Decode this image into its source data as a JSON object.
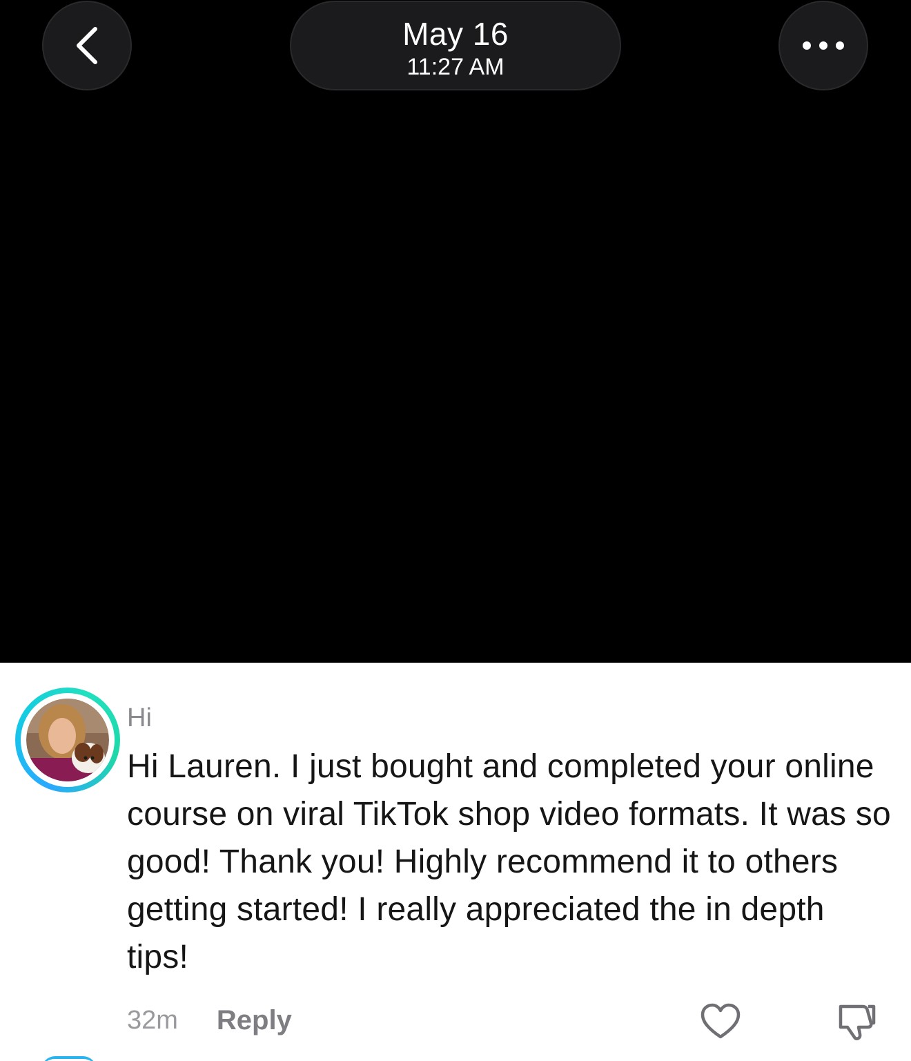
{
  "header": {
    "date": "May 16",
    "time": "11:27 AM",
    "back_icon": "chevron-left-icon",
    "more_icon": "ellipsis-icon"
  },
  "comment": {
    "username": "Hi",
    "text": "Hi Lauren. I just bought and completed your online course on viral TikTok shop video formats. It was so good! Thank you! Highly recommend it to others getting started! I really appreciated the in depth tips!",
    "age": "32m",
    "reply_label": "Reply",
    "like_icon": "heart-icon",
    "dislike_icon": "thumbs-down-icon"
  },
  "colors": {
    "background_top": "#000000",
    "background_bottom": "#ffffff",
    "button_bg": "#1b1b1d",
    "ring_start": "#2aa8ff",
    "ring_end": "#20e0c0",
    "muted_text": "#8a8a8e",
    "body_text": "#161616"
  }
}
